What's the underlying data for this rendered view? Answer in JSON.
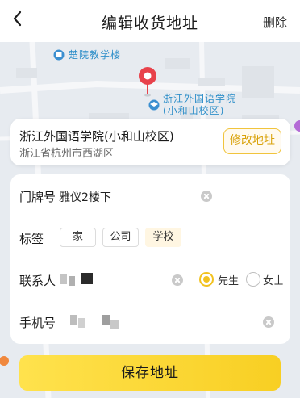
{
  "header": {
    "title": "编辑收货地址",
    "delete_label": "删除"
  },
  "map": {
    "poi_1": "楚院教学楼",
    "poi_2_line1": "浙江外国语学院",
    "poi_2_line2": "(小和山校区)"
  },
  "location": {
    "name": "浙江外国语学院(小和山校区)",
    "address": "浙江省杭州市西湖区",
    "modify_label": "修改地址"
  },
  "form": {
    "door": {
      "label": "门牌号",
      "value": "雅仪2楼下"
    },
    "tags": {
      "label": "标签",
      "items": [
        "家",
        "公司",
        "学校"
      ],
      "selected": "学校"
    },
    "contact": {
      "label": "联系人",
      "gender_options": [
        "先生",
        "女士"
      ],
      "selected_gender": "先生"
    },
    "phone": {
      "label": "手机号"
    }
  },
  "save_label": "保存地址",
  "colors": {
    "accent": "#f2c21f",
    "modify_text": "#d9a20a",
    "map_label": "#2f8fc9",
    "pin": "#e8424b"
  }
}
